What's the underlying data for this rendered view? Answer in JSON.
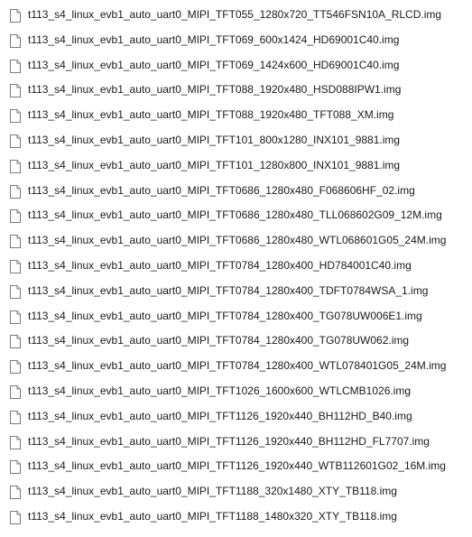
{
  "file_icon": "generic-file-icon",
  "files": [
    "t113_s4_linux_evb1_auto_uart0_MIPI_TFT055_1280x720_TT546FSN10A_RLCD.img",
    "t113_s4_linux_evb1_auto_uart0_MIPI_TFT069_600x1424_HD69001C40.img",
    "t113_s4_linux_evb1_auto_uart0_MIPI_TFT069_1424x600_HD69001C40.img",
    "t113_s4_linux_evb1_auto_uart0_MIPI_TFT088_1920x480_HSD088IPW1.img",
    "t113_s4_linux_evb1_auto_uart0_MIPI_TFT088_1920x480_TFT088_XM.img",
    "t113_s4_linux_evb1_auto_uart0_MIPI_TFT101_800x1280_INX101_9881.img",
    "t113_s4_linux_evb1_auto_uart0_MIPI_TFT101_1280x800_INX101_9881.img",
    "t113_s4_linux_evb1_auto_uart0_MIPI_TFT0686_1280x480_F068606HF_02.img",
    "t113_s4_linux_evb1_auto_uart0_MIPI_TFT0686_1280x480_TLL068602G09_12M.img",
    "t113_s4_linux_evb1_auto_uart0_MIPI_TFT0686_1280x480_WTL068601G05_24M.img",
    "t113_s4_linux_evb1_auto_uart0_MIPI_TFT0784_1280x400_HD784001C40.img",
    "t113_s4_linux_evb1_auto_uart0_MIPI_TFT0784_1280x400_TDFT0784WSA_1.img",
    "t113_s4_linux_evb1_auto_uart0_MIPI_TFT0784_1280x400_TG078UW006E1.img",
    "t113_s4_linux_evb1_auto_uart0_MIPI_TFT0784_1280x400_TG078UW062.img",
    "t113_s4_linux_evb1_auto_uart0_MIPI_TFT0784_1280x400_WTL078401G05_24M.img",
    "t113_s4_linux_evb1_auto_uart0_MIPI_TFT1026_1600x600_WTLCMB1026.img",
    "t113_s4_linux_evb1_auto_uart0_MIPI_TFT1126_1920x440_BH112HD_B40.img",
    "t113_s4_linux_evb1_auto_uart0_MIPI_TFT1126_1920x440_BH112HD_FL7707.img",
    "t113_s4_linux_evb1_auto_uart0_MIPI_TFT1126_1920x440_WTB112601G02_16M.img",
    "t113_s4_linux_evb1_auto_uart0_MIPI_TFT1188_320x1480_XTY_TB118.img",
    "t113_s4_linux_evb1_auto_uart0_MIPI_TFT1188_1480x320_XTY_TB118.img"
  ]
}
